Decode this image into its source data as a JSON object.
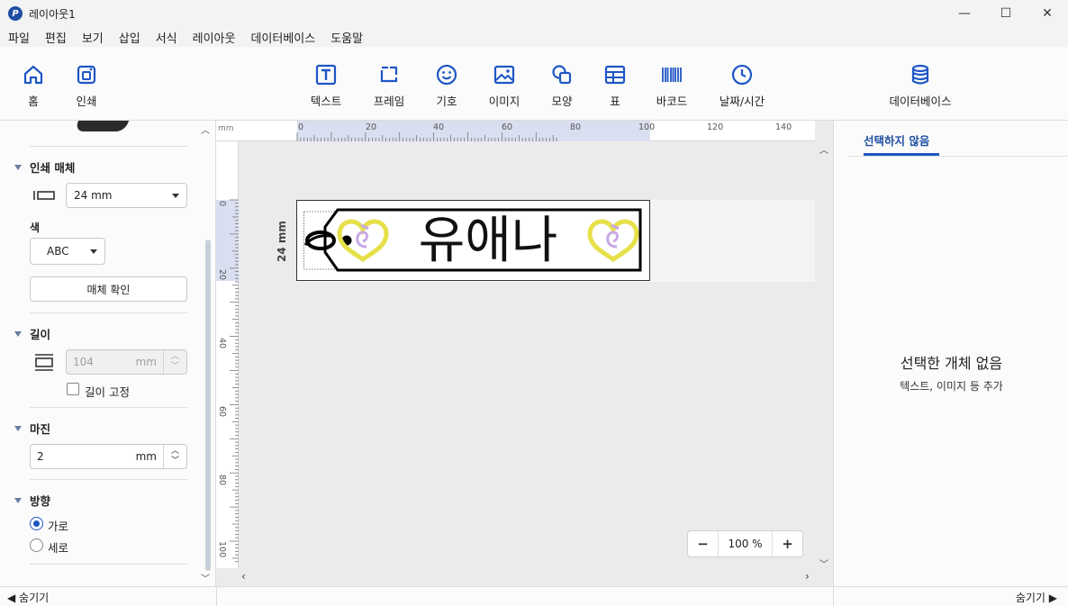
{
  "window": {
    "title": "레이아웃1",
    "controls": {
      "minimize": "—",
      "maximize": "☐",
      "close": "✕"
    }
  },
  "menu": [
    "파일",
    "편집",
    "보기",
    "삽입",
    "서식",
    "레이아웃",
    "데이터베이스",
    "도움말"
  ],
  "ribbon": {
    "home": "홈",
    "print": "인쇄",
    "text": "텍스트",
    "frame": "프레임",
    "symbol": "기호",
    "image": "이미지",
    "shape": "모양",
    "table": "표",
    "barcode": "바코드",
    "datetime": "날짜/시간",
    "database": "데이터베이스"
  },
  "left_panel": {
    "media": {
      "heading": "인쇄 매체",
      "width_value": "24 mm",
      "color_label": "색",
      "color_value": "ABC",
      "check_button": "매체 확인"
    },
    "length": {
      "heading": "길이",
      "value": "104",
      "unit": "mm",
      "fixed_label": "길이 고정",
      "fixed_checked": false
    },
    "margin": {
      "heading": "마진",
      "value": "2",
      "unit": "mm"
    },
    "orientation": {
      "heading": "방향",
      "options": [
        "가로",
        "세로"
      ],
      "selected": "가로"
    }
  },
  "canvas": {
    "ruler_unit": "mm",
    "h_ticks": [
      "0",
      "20",
      "40",
      "60",
      "80",
      "100",
      "120",
      "140"
    ],
    "v_ticks": [
      "0",
      "20",
      "40",
      "60",
      "80",
      "100"
    ],
    "tape_width_label": "24 mm",
    "label_text": "유애나",
    "zoom": {
      "minus": "−",
      "value": "100 %",
      "plus": "+"
    },
    "arrows": {
      "up": "▲",
      "down": "▼",
      "left": "‹",
      "right": "›"
    }
  },
  "right_panel": {
    "tab": "선택하지 않음",
    "empty_title": "선택한 개체 없음",
    "empty_sub": "텍스트, 이미지 등 추가"
  },
  "status": {
    "left": "◀ 숨기기",
    "right": "숨기기 ▶"
  },
  "colors": {
    "accent": "#1e56c5",
    "ruler_highlight": "#d9dff0",
    "heart_yellow": "#e6e04a",
    "heart_purple": "#c8a8e6"
  }
}
